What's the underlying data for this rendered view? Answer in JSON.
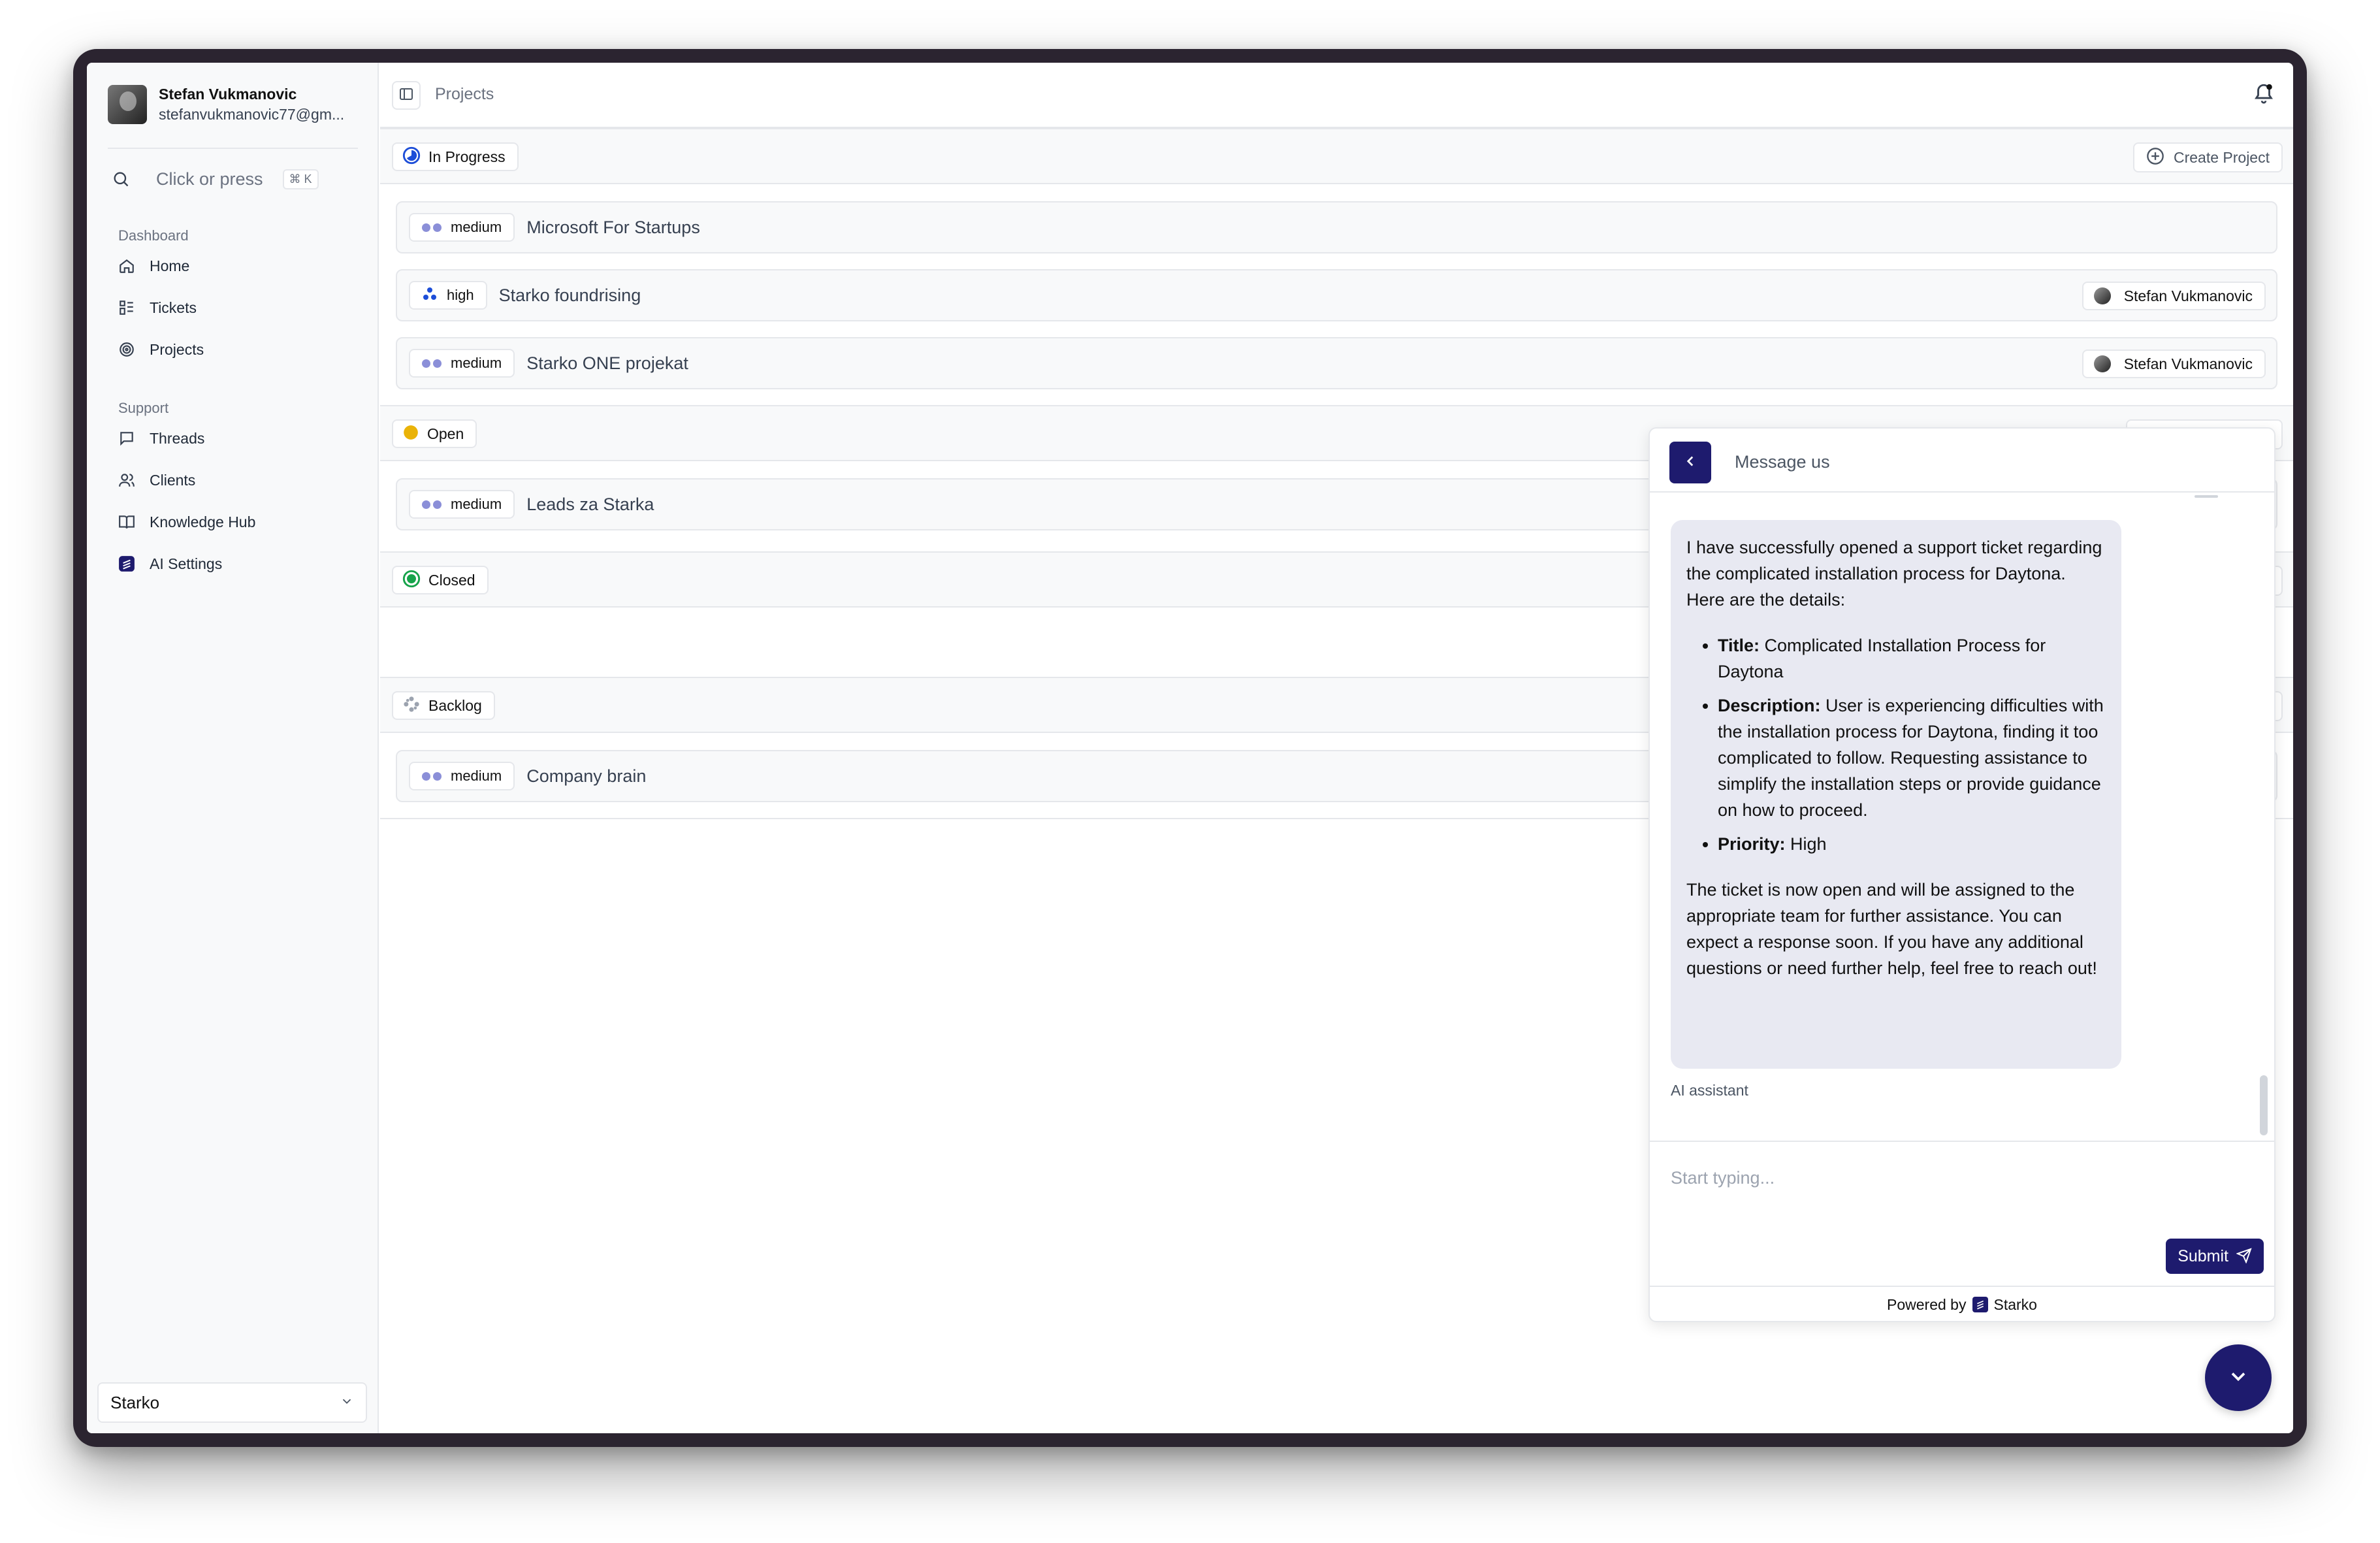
{
  "user": {
    "name": "Stefan Vukmanovic",
    "email": "stefanvukmanovic77@gm..."
  },
  "search": {
    "label": "Click or press",
    "shortcut": "⌘ K"
  },
  "sidebar": {
    "dashboard_label": "Dashboard",
    "dashboard_items": [
      {
        "label": "Home",
        "icon": "home-icon"
      },
      {
        "label": "Tickets",
        "icon": "tickets-icon"
      },
      {
        "label": "Projects",
        "icon": "projects-icon"
      }
    ],
    "support_label": "Support",
    "support_items": [
      {
        "label": "Threads",
        "icon": "chat-icon"
      },
      {
        "label": "Clients",
        "icon": "users-icon"
      },
      {
        "label": "Knowledge Hub",
        "icon": "book-icon"
      },
      {
        "label": "AI Settings",
        "icon": "ai-settings-icon"
      }
    ],
    "workspace": "Starko"
  },
  "header": {
    "breadcrumb": "Projects"
  },
  "groups": [
    {
      "status": "In Progress",
      "action": "Create Project",
      "projects": [
        {
          "priority": "medium",
          "title": "Microsoft For Startups",
          "assignee": ""
        },
        {
          "priority": "high",
          "title": "Starko foundrising",
          "assignee": "Stefan Vukmanovic"
        },
        {
          "priority": "medium",
          "title": "Starko ONE projekat",
          "assignee": "Stefan Vukmanovic"
        }
      ]
    },
    {
      "status": "Open",
      "projects": [
        {
          "priority": "medium",
          "title": "Leads za Starka"
        }
      ]
    },
    {
      "status": "Closed",
      "projects": []
    },
    {
      "status": "Backlog",
      "projects": [
        {
          "priority": "medium",
          "title": "Company brain"
        }
      ]
    }
  ],
  "chat": {
    "title": "Message us",
    "message": {
      "intro": "I have successfully opened a support ticket regarding the complicated installation process for Daytona. Here are the details:",
      "details": [
        {
          "key": "Title:",
          "value": " Complicated Installation Process for Daytona"
        },
        {
          "key": "Description:",
          "value": " User is experiencing difficulties with the installation process for Daytona, finding it too complicated to follow. Requesting assistance to simplify the installation steps or provide guidance on how to proceed."
        },
        {
          "key": "Priority:",
          "value": " High"
        }
      ],
      "outro": "The ticket is now open and will be assigned to the appropriate team for further assistance. You can expect a response soon. If you have any additional questions or need further help, feel free to reach out!"
    },
    "sender": "AI assistant",
    "input_placeholder": "Start typing...",
    "submit_label": "Submit",
    "powered_prefix": "Powered by",
    "powered_brand": "Starko"
  },
  "colors": {
    "accent": "#1e1b6e",
    "in_progress": "#1d4ed8",
    "open": "#eab308",
    "closed": "#16a34a",
    "medium": "#8b8fd8",
    "high": "#1d4ed8"
  }
}
